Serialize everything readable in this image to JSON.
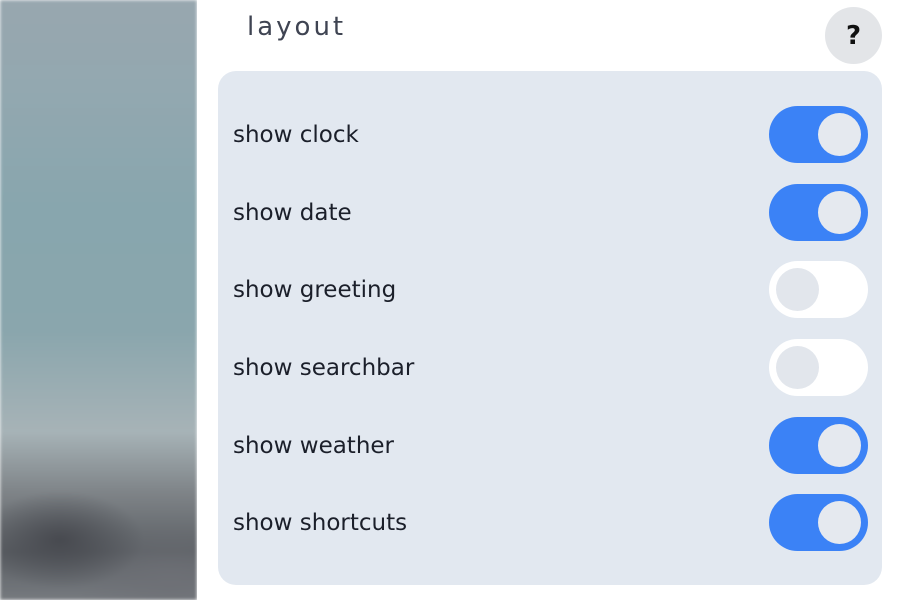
{
  "panel": {
    "title": "layout",
    "help_glyph": "?"
  },
  "colors": {
    "toggle_on": "#3b82f6",
    "toggle_off": "#ffffff",
    "card_background": "#e2e8f0"
  },
  "icons": {
    "help": "question-mark-icon"
  },
  "settings": [
    {
      "label": "show clock",
      "enabled": true
    },
    {
      "label": "show date",
      "enabled": true
    },
    {
      "label": "show greeting",
      "enabled": false
    },
    {
      "label": "show searchbar",
      "enabled": false
    },
    {
      "label": "show weather",
      "enabled": true
    },
    {
      "label": "show shortcuts",
      "enabled": true
    }
  ]
}
